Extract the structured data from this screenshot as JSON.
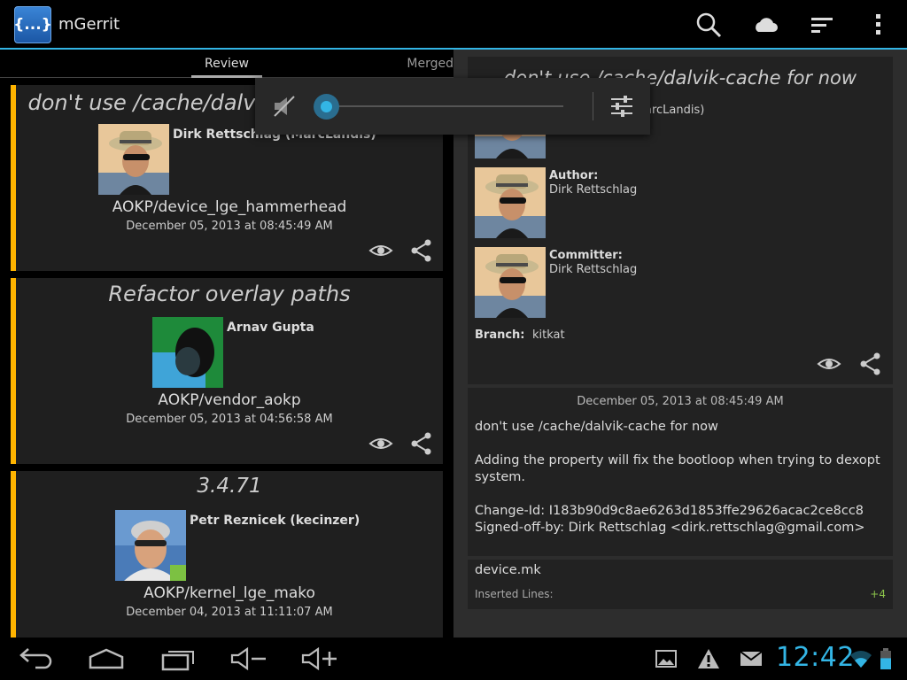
{
  "action_bar": {
    "app_icon_text": "{...}",
    "title": "mGerrit",
    "icons": [
      "search-icon",
      "cloud-icon",
      "sort-icon",
      "overflow-menu-icon"
    ]
  },
  "tabs": [
    "Review",
    "Merged"
  ],
  "selected_tab": "Review",
  "changes": [
    {
      "subject": "don't use /cache/dalvik-cache for now",
      "owner": "Dirk Rettschlag (MarcLandis)",
      "project": "AOKP/device_lge_hammerhead",
      "date": "December 05, 2013 at 08:45:49 AM"
    },
    {
      "subject": "Refactor overlay paths",
      "owner": "Arnav Gupta",
      "project": "AOKP/vendor_aokp",
      "date": "December 05, 2013 at 04:56:58 AM"
    },
    {
      "subject": "3.4.71",
      "owner": "Petr Reznicek (kecinzer)",
      "project": "AOKP/kernel_lge_mako",
      "date": "December 04, 2013 at 11:11:07 AM"
    }
  ],
  "detail": {
    "title": "don't use /cache/dalvik-cache for now",
    "owner_partial": "arcLandis)",
    "author_label": "Author:",
    "author": "Dirk Rettschlag",
    "committer_label": "Committer:",
    "committer": "Dirk Rettschlag",
    "branch_label": "Branch:",
    "branch": "kitkat",
    "message": {
      "date": "December 05, 2013 at 08:45:49 AM",
      "lines": [
        "don't use /cache/dalvik-cache for now",
        "Adding the property will fix the bootloop when trying to dexopt",
        "system.",
        "Change-Id: I183b90d9c8ae6263d1853ffe29626acac2ce8cc8",
        "Signed-off-by: Dirk Rettschlag <dirk.rettschlag@gmail.com>"
      ]
    },
    "file": {
      "name": "device.mk",
      "inserted_label": "Inserted Lines:",
      "inserted_count": "+4"
    }
  },
  "volume_popup": {
    "muted": true,
    "level": 0
  },
  "status_bar": {
    "time": "12:42",
    "battery_level": 0.6
  },
  "colors": {
    "accent": "#33b5e5",
    "card_stripe": "#ffb400",
    "insert_green": "#8bc34a"
  }
}
